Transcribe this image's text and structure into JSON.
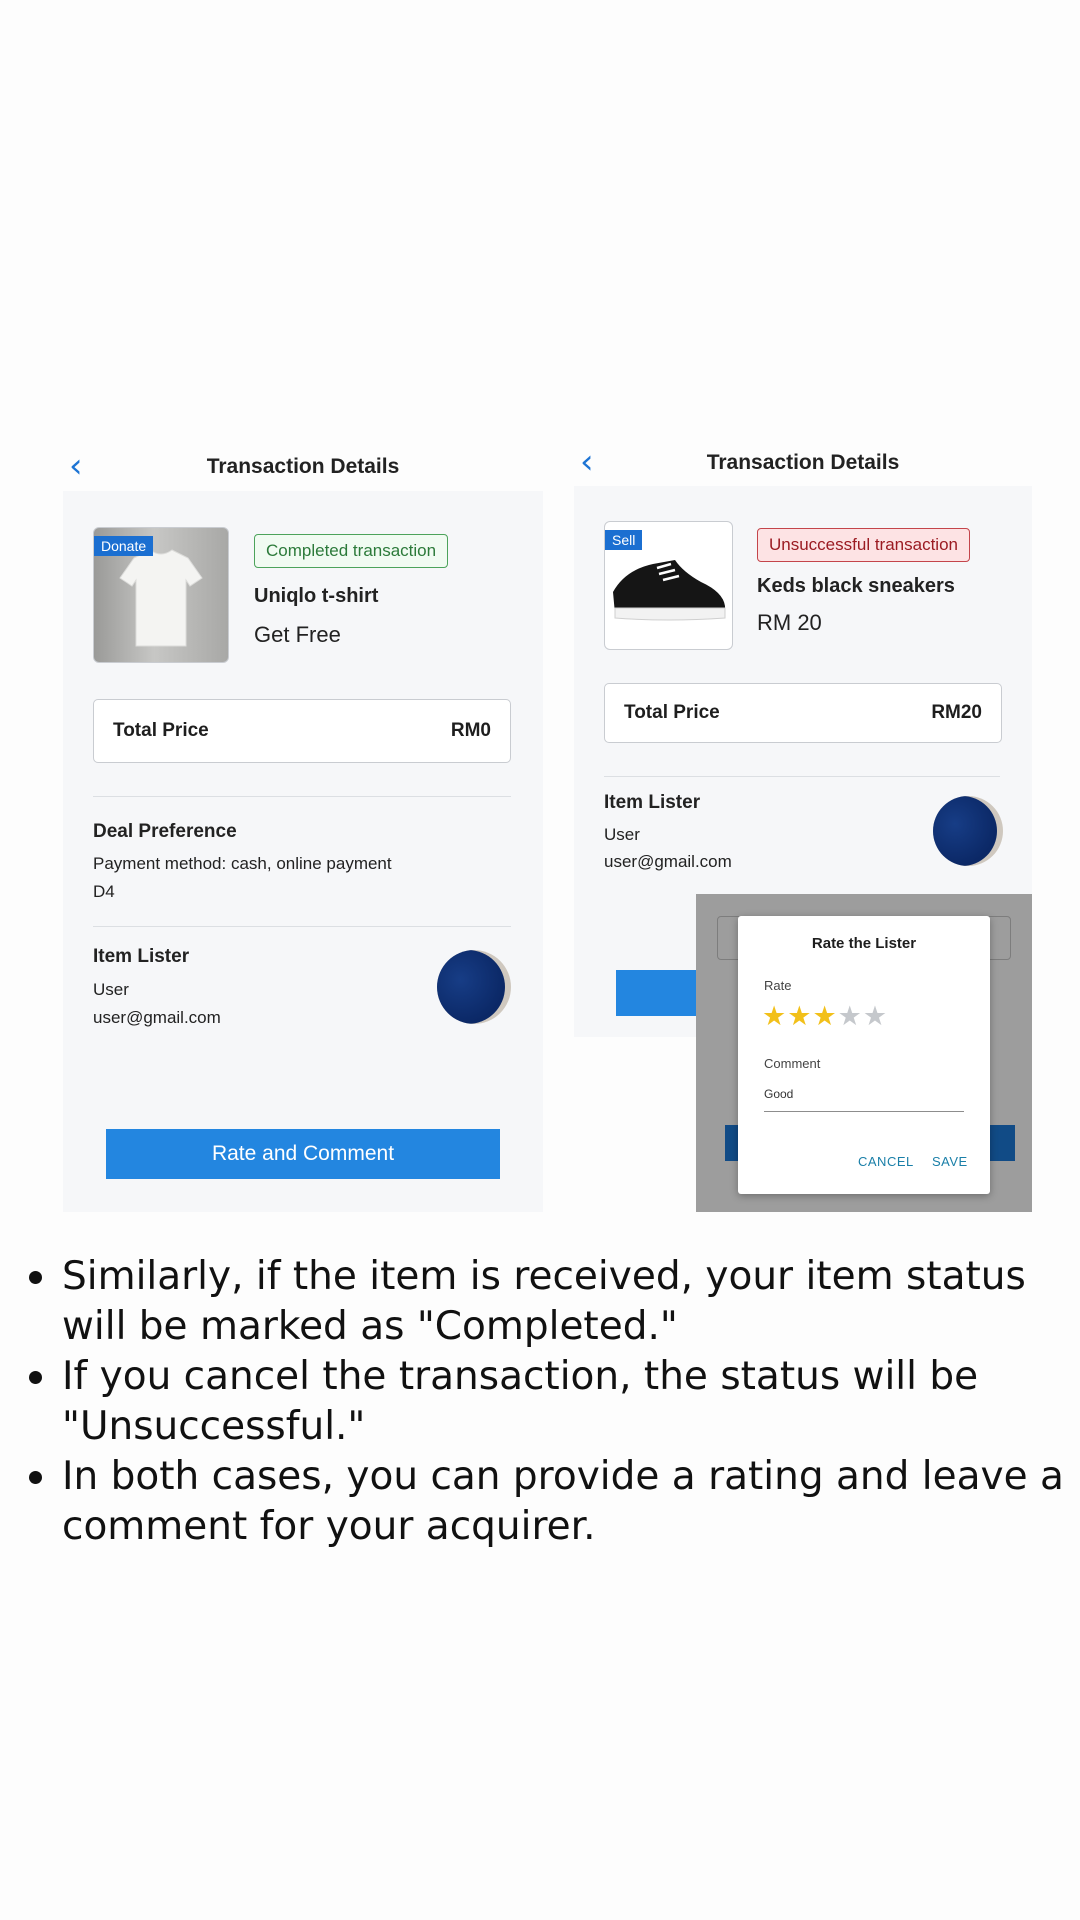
{
  "left_screen": {
    "nav": {
      "back_icon": "chevron-left",
      "title": "Transaction Details"
    },
    "item": {
      "tag": "Donate",
      "status": "Completed transaction",
      "name": "Uniqlo t-shirt",
      "price": "Get Free"
    },
    "total": {
      "label": "Total Price",
      "value": "RM0"
    },
    "deal": {
      "heading": "Deal Preference",
      "payment": "Payment method: cash, online payment",
      "location": "D4"
    },
    "lister": {
      "heading": "Item Lister",
      "name": "User",
      "email": "user@gmail.com"
    },
    "button": "Rate and Comment"
  },
  "right_screen": {
    "nav": {
      "back_icon": "chevron-left",
      "title": "Transaction Details"
    },
    "item": {
      "tag": "Sell",
      "status": "Unsuccessful transaction",
      "name": "Keds black sneakers",
      "price": "RM 20"
    },
    "total": {
      "label": "Total Price",
      "value": "RM20"
    },
    "lister": {
      "heading": "Item Lister",
      "name": "User",
      "email": "user@gmail.com"
    },
    "dialog": {
      "title": "Rate the Lister",
      "rate_label": "Rate",
      "rating": 3,
      "max_rating": 5,
      "comment_label": "Comment",
      "comment_value": "Good",
      "cancel": "CANCEL",
      "save": "SAVE"
    }
  },
  "colors": {
    "accent": "#2386e0",
    "success": "#4ca35b",
    "danger": "#c4454b",
    "star": "#f2c01a"
  },
  "bullets": [
    "Similarly, if the item is received, your item status will be marked as \"Completed.\"",
    "If you cancel the transaction, the status will be \"Unsuccessful.\"",
    "In both cases, you can provide a rating and leave a comment for your acquirer."
  ]
}
